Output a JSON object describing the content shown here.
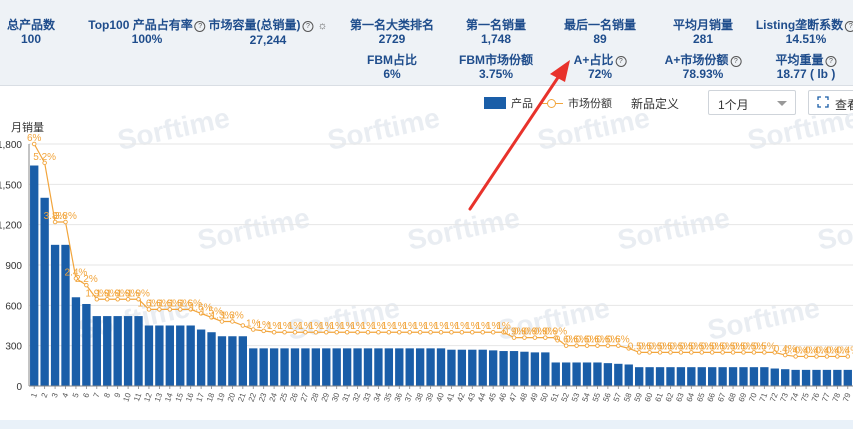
{
  "stats": [
    {
      "id": "total-products",
      "label": "总产品数",
      "value": "100",
      "help": false,
      "x": 31,
      "y": 18,
      "row": 1
    },
    {
      "id": "top100-share",
      "label": "Top100 产品占有率",
      "value": "100%",
      "help": true,
      "x": 147,
      "y": 18,
      "row": 1
    },
    {
      "id": "market-volume",
      "label": "市场容量(总销量)",
      "value": "27,244",
      "help": true,
      "x": 268,
      "y": 18,
      "row": 1
    },
    {
      "id": "top1-rank",
      "label": "第一名大类排名",
      "value": "2729",
      "help": false,
      "x": 392,
      "y": 18,
      "row": 1
    },
    {
      "id": "top1-sales",
      "label": "第一名销量",
      "value": "1,748",
      "help": false,
      "x": 496,
      "y": 18,
      "row": 1
    },
    {
      "id": "last-sales",
      "label": "最后一名销量",
      "value": "89",
      "help": false,
      "x": 600,
      "y": 18,
      "row": 1
    },
    {
      "id": "avg-monthly",
      "label": "平均月销量",
      "value": "281",
      "help": false,
      "x": 703,
      "y": 18,
      "row": 1
    },
    {
      "id": "listing-coef",
      "label": "Listing垄断系数",
      "value": "14.51%",
      "help": true,
      "x": 806,
      "y": 18,
      "row": 1
    },
    {
      "id": "fbm-ratio",
      "label": "FBM占比",
      "value": "6%",
      "help": false,
      "x": 392,
      "y": 53,
      "row": 2
    },
    {
      "id": "fbm-share",
      "label": "FBM市场份额",
      "value": "3.75%",
      "help": false,
      "x": 496,
      "y": 53,
      "row": 2
    },
    {
      "id": "aplus-ratio",
      "label": "A+占比",
      "value": "72%",
      "help": true,
      "x": 600,
      "y": 53,
      "row": 2
    },
    {
      "id": "aplus-share",
      "label": "A+市场份额",
      "value": "78.93%",
      "help": true,
      "x": 703,
      "y": 53,
      "row": 2
    },
    {
      "id": "avg-weight",
      "label": "平均重量",
      "value": "18.77 ( lb )",
      "help": true,
      "x": 806,
      "y": 53,
      "row": 2
    }
  ],
  "toolbar": {
    "legend_bar": "产品",
    "legend_line": "市场份额",
    "new_def_label": "新品定义",
    "period_value": "1个月",
    "view_label": "查看"
  },
  "colors": {
    "bar": "#1a5ea8",
    "line": "#f2a53c",
    "axis": "#555",
    "grid": "#e6e6e6",
    "header_text": "#1f4d8c",
    "arrow": "#e8322b"
  },
  "watermark": "Sorftime",
  "chart_data": {
    "type": "bar",
    "ylabel": "月销量",
    "ylim": [
      0,
      1800
    ],
    "yticks": [
      0,
      300,
      600,
      900,
      1200,
      1500,
      1800
    ],
    "ytick_labels": [
      "0",
      "300",
      "600",
      "900",
      "1,200",
      "1,500",
      "1,800"
    ],
    "categories": [
      "1",
      "2",
      "3",
      "4",
      "5",
      "6",
      "7",
      "8",
      "9",
      "10",
      "11",
      "12",
      "13",
      "14",
      "15",
      "16",
      "17",
      "18",
      "19",
      "20",
      "21",
      "22",
      "23",
      "24",
      "25",
      "26",
      "27",
      "28",
      "29",
      "30",
      "31",
      "32",
      "33",
      "34",
      "35",
      "36",
      "37",
      "38",
      "39",
      "40",
      "41",
      "42",
      "43",
      "44",
      "45",
      "46",
      "47",
      "48",
      "49",
      "50",
      "51",
      "52",
      "53",
      "54",
      "55",
      "56",
      "57",
      "58",
      "59",
      "60",
      "61",
      "62",
      "63",
      "64",
      "65",
      "66",
      "67",
      "68",
      "69",
      "70",
      "71",
      "72",
      "73",
      "74",
      "75",
      "76",
      "77",
      "78",
      "79"
    ],
    "series": [
      {
        "name": "产品",
        "type": "bar",
        "values": [
          1640,
          1400,
          1050,
          1050,
          660,
          610,
          520,
          520,
          520,
          520,
          520,
          450,
          450,
          450,
          450,
          450,
          420,
          400,
          370,
          370,
          370,
          280,
          280,
          280,
          280,
          280,
          280,
          280,
          280,
          280,
          280,
          280,
          280,
          280,
          280,
          280,
          280,
          280,
          280,
          280,
          270,
          270,
          270,
          270,
          265,
          260,
          260,
          255,
          250,
          250,
          175,
          175,
          175,
          175,
          175,
          170,
          165,
          160,
          140,
          140,
          140,
          140,
          140,
          140,
          140,
          140,
          140,
          140,
          140,
          140,
          140,
          130,
          125,
          120,
          120,
          120,
          120,
          120,
          120
        ]
      },
      {
        "name": "市场份额",
        "type": "line",
        "values": [
          1800,
          1660,
          1220,
          1220,
          800,
          750,
          645,
          645,
          645,
          645,
          645,
          570,
          570,
          570,
          570,
          570,
          540,
          510,
          480,
          480,
          450,
          420,
          410,
          400,
          400,
          400,
          400,
          400,
          400,
          400,
          400,
          400,
          400,
          400,
          400,
          400,
          400,
          400,
          400,
          400,
          400,
          400,
          400,
          400,
          400,
          400,
          360,
          360,
          360,
          360,
          360,
          300,
          300,
          300,
          300,
          300,
          300,
          280,
          250,
          250,
          250,
          250,
          250,
          250,
          250,
          250,
          250,
          250,
          250,
          250,
          250,
          250,
          230,
          220,
          220,
          220,
          220,
          220,
          220
        ],
        "point_labels": [
          {
            "index": 0,
            "text": "6%"
          },
          {
            "index": 1,
            "text": "5.2%"
          },
          {
            "index": 2,
            "text": "3.8%"
          },
          {
            "index": 3,
            "text": "3.8%"
          },
          {
            "index": 4,
            "text": "2.4%"
          },
          {
            "index": 5,
            "text": "2.2%"
          },
          {
            "index": 6,
            "text": "1.9%"
          },
          {
            "index": 7,
            "text": "1.9%"
          },
          {
            "index": 8,
            "text": "1.9%"
          },
          {
            "index": 9,
            "text": "1.9%"
          },
          {
            "index": 10,
            "text": "1.9%"
          },
          {
            "index": 11,
            "text": "1.6%"
          },
          {
            "index": 12,
            "text": "1.6%"
          },
          {
            "index": 13,
            "text": "1.6%"
          },
          {
            "index": 14,
            "text": "1.6%"
          },
          {
            "index": 15,
            "text": "1.6%"
          },
          {
            "index": 16,
            "text": "1.6%"
          },
          {
            "index": 17,
            "text": "1.5%"
          },
          {
            "index": 18,
            "text": "1.3%"
          },
          {
            "index": 19,
            "text": "1.3%"
          },
          {
            "index": 21,
            "text": "1%"
          },
          {
            "index": 22,
            "text": "1%"
          },
          {
            "index": 23,
            "text": "1%"
          },
          {
            "index": 24,
            "text": "1%"
          },
          {
            "index": 25,
            "text": "1%"
          },
          {
            "index": 26,
            "text": "1%"
          },
          {
            "index": 27,
            "text": "1%"
          },
          {
            "index": 28,
            "text": "1%"
          },
          {
            "index": 29,
            "text": "1%"
          },
          {
            "index": 30,
            "text": "1%"
          },
          {
            "index": 31,
            "text": "1%"
          },
          {
            "index": 32,
            "text": "1%"
          },
          {
            "index": 33,
            "text": "1%"
          },
          {
            "index": 34,
            "text": "1%"
          },
          {
            "index": 35,
            "text": "1%"
          },
          {
            "index": 36,
            "text": "1%"
          },
          {
            "index": 37,
            "text": "1%"
          },
          {
            "index": 38,
            "text": "1%"
          },
          {
            "index": 39,
            "text": "1%"
          },
          {
            "index": 40,
            "text": "1%"
          },
          {
            "index": 41,
            "text": "1%"
          },
          {
            "index": 42,
            "text": "1%"
          },
          {
            "index": 43,
            "text": "1%"
          },
          {
            "index": 44,
            "text": "1%"
          },
          {
            "index": 45,
            "text": "1%"
          },
          {
            "index": 46,
            "text": "0.9%"
          },
          {
            "index": 47,
            "text": "0.9%"
          },
          {
            "index": 48,
            "text": "0.9%"
          },
          {
            "index": 49,
            "text": "0.9%"
          },
          {
            "index": 50,
            "text": "0.9%"
          },
          {
            "index": 51,
            "text": "0.6%"
          },
          {
            "index": 52,
            "text": "0.6%"
          },
          {
            "index": 53,
            "text": "0.6%"
          },
          {
            "index": 54,
            "text": "0.6%"
          },
          {
            "index": 55,
            "text": "0.6%"
          },
          {
            "index": 56,
            "text": "0.6%"
          },
          {
            "index": 58,
            "text": "0.5%"
          },
          {
            "index": 59,
            "text": "0.5%"
          },
          {
            "index": 60,
            "text": "0.5%"
          },
          {
            "index": 61,
            "text": "0.5%"
          },
          {
            "index": 62,
            "text": "0.5%"
          },
          {
            "index": 63,
            "text": "0.5%"
          },
          {
            "index": 64,
            "text": "0.5%"
          },
          {
            "index": 65,
            "text": "0.5%"
          },
          {
            "index": 66,
            "text": "0.5%"
          },
          {
            "index": 67,
            "text": "0.5%"
          },
          {
            "index": 68,
            "text": "0.5%"
          },
          {
            "index": 69,
            "text": "0.5%"
          },
          {
            "index": 70,
            "text": "0.5%"
          },
          {
            "index": 72,
            "text": "0.4%"
          },
          {
            "index": 73,
            "text": "0.4%"
          },
          {
            "index": 74,
            "text": "0.4%"
          },
          {
            "index": 75,
            "text": "0.4%"
          },
          {
            "index": 76,
            "text": "0.4%"
          },
          {
            "index": 77,
            "text": "0.4%"
          },
          {
            "index": 78,
            "text": "0.4%"
          }
        ]
      }
    ],
    "grid": true
  }
}
